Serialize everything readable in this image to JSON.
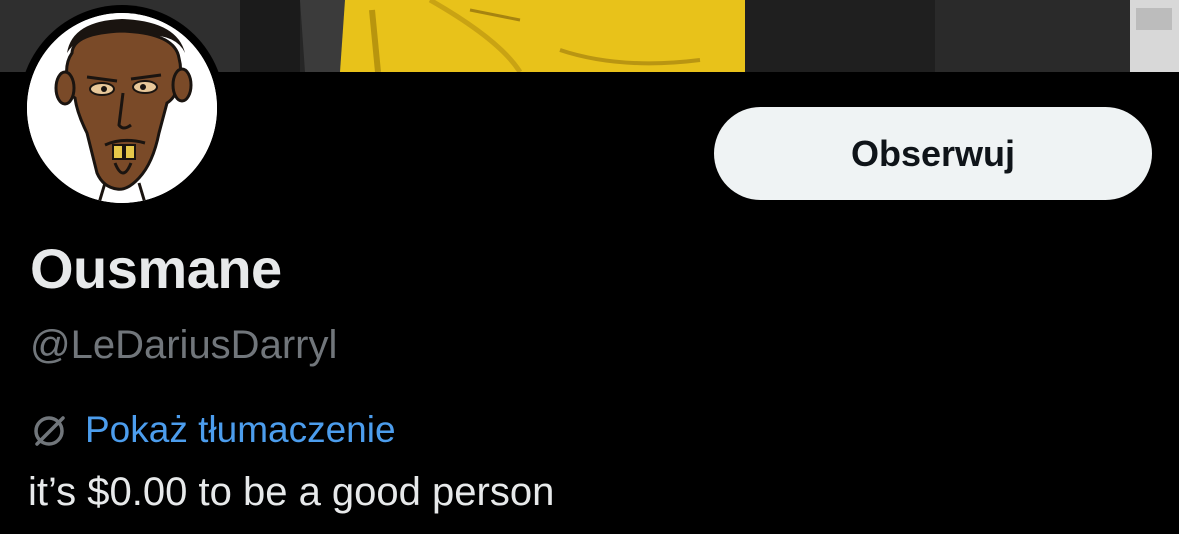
{
  "profile": {
    "display_name": "Ousmane",
    "handle": "@LeDariusDarryl",
    "follow_label": "Obserwuj",
    "translate_label": "Pokaż tłumaczenie",
    "bio": "it’s $0.00 to be a good person"
  },
  "icons": {
    "translate": "globe-slash-icon"
  },
  "colors": {
    "background": "#000000",
    "text_primary": "#e7e9ea",
    "text_secondary": "#71767b",
    "link": "#4c9ded",
    "button_bg": "#eff3f4",
    "button_text": "#0f1419"
  }
}
